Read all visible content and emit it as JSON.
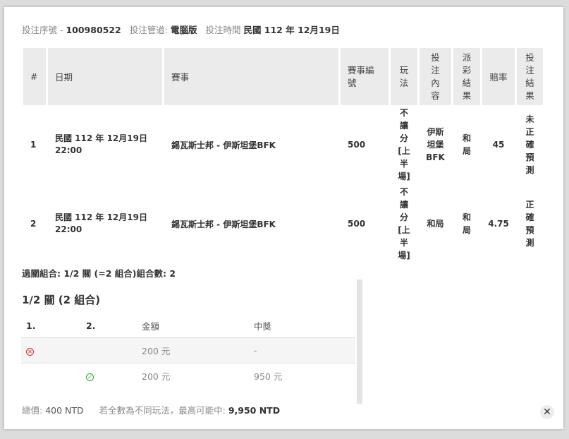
{
  "header": {
    "serial_label": "投注序號 -",
    "serial_value": "100980522",
    "channel_label": "投注管道:",
    "channel_value": "電腦版",
    "time_label": "投注時間",
    "time_value": "民國 112 年 12月19日"
  },
  "bets_table": {
    "columns": [
      "#",
      "日期",
      "賽事",
      "賽事編號",
      "玩法",
      "投注內容",
      "派彩結果",
      "賠率",
      "投注結果"
    ],
    "columns_vertical": {
      "play": [
        "玩",
        "法"
      ],
      "content": [
        "投",
        "注",
        "內",
        "容"
      ],
      "payout": [
        "派",
        "彩",
        "結",
        "果"
      ],
      "result": [
        "投",
        "注",
        "結",
        "果"
      ]
    },
    "rows": [
      {
        "index": "1",
        "date_line1": "民國 112 年 12月19日",
        "date_line2": "22:00",
        "match": "錫瓦斯士邦 - 伊斯坦堡BFK",
        "match_no": "500",
        "play": [
          "不",
          "讓",
          "分",
          "[上",
          "半",
          "場]"
        ],
        "content": [
          "伊斯",
          "坦堡",
          "BFK"
        ],
        "payout": [
          "和",
          "局"
        ],
        "odds": "45",
        "result": [
          "未",
          "正",
          "確",
          "預",
          "測"
        ]
      },
      {
        "index": "2",
        "date_line1": "民國 112 年 12月19日",
        "date_line2": "22:00",
        "match": "錫瓦斯士邦 - 伊斯坦堡BFK",
        "match_no": "500",
        "play": [
          "不",
          "讓",
          "分",
          "[上",
          "半",
          "場]"
        ],
        "content": [
          "和局"
        ],
        "payout": [
          "和",
          "局"
        ],
        "odds": "4.75",
        "result": [
          "正",
          "確",
          "預",
          "測"
        ]
      }
    ]
  },
  "parlay_summary": "過關組合: 1/2 關 (=2 組合)組合數: 2",
  "combo": {
    "title": "1/2 關 (2 組合)",
    "headers": {
      "leg1": "1.",
      "leg2": "2.",
      "amount": "金額",
      "prize": "中獎"
    },
    "rows": [
      {
        "leg1_icon": "cross-circle-icon",
        "leg2_icon": "",
        "amount": "200 元",
        "prize": "-"
      },
      {
        "leg1_icon": "",
        "leg2_icon": "check-circle-icon",
        "amount": "200 元",
        "prize": "950 元"
      }
    ]
  },
  "footer": {
    "total_label": "總價:",
    "total_value": "400 NTD",
    "note": "若全數為不同玩法，最高可能中:",
    "max_value": "9,950 NTD"
  },
  "close_glyph": "✕"
}
